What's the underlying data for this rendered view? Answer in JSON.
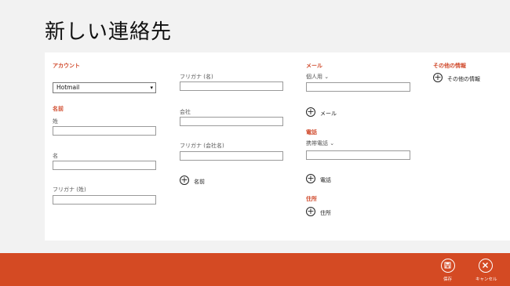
{
  "page": {
    "title": "新しい連絡先"
  },
  "account": {
    "section": "アカウント",
    "selected": "Hotmail"
  },
  "name": {
    "section": "名前",
    "last_label": "姓",
    "first_label": "名",
    "furigana_last_label": "フリガナ (姓)",
    "furigana_first_label": "フリガナ (名)",
    "company_label": "会社",
    "furigana_company_label": "フリガナ (会社名)",
    "add_label": "名前"
  },
  "email": {
    "section": "メール",
    "type_label": "個人用",
    "add_label": "メール"
  },
  "phone": {
    "section": "電話",
    "type_label": "携帯電話",
    "add_label": "電話"
  },
  "address": {
    "section": "住所",
    "add_label": "住所"
  },
  "other": {
    "section": "その他の情報",
    "add_label": "その他の情報"
  },
  "appbar": {
    "save_label": "保存",
    "cancel_label": "キャンセル",
    "color": "#d44a23"
  },
  "icons": {
    "plus": "+",
    "chevron": "⌄",
    "dropdown_arrow": "▾"
  }
}
